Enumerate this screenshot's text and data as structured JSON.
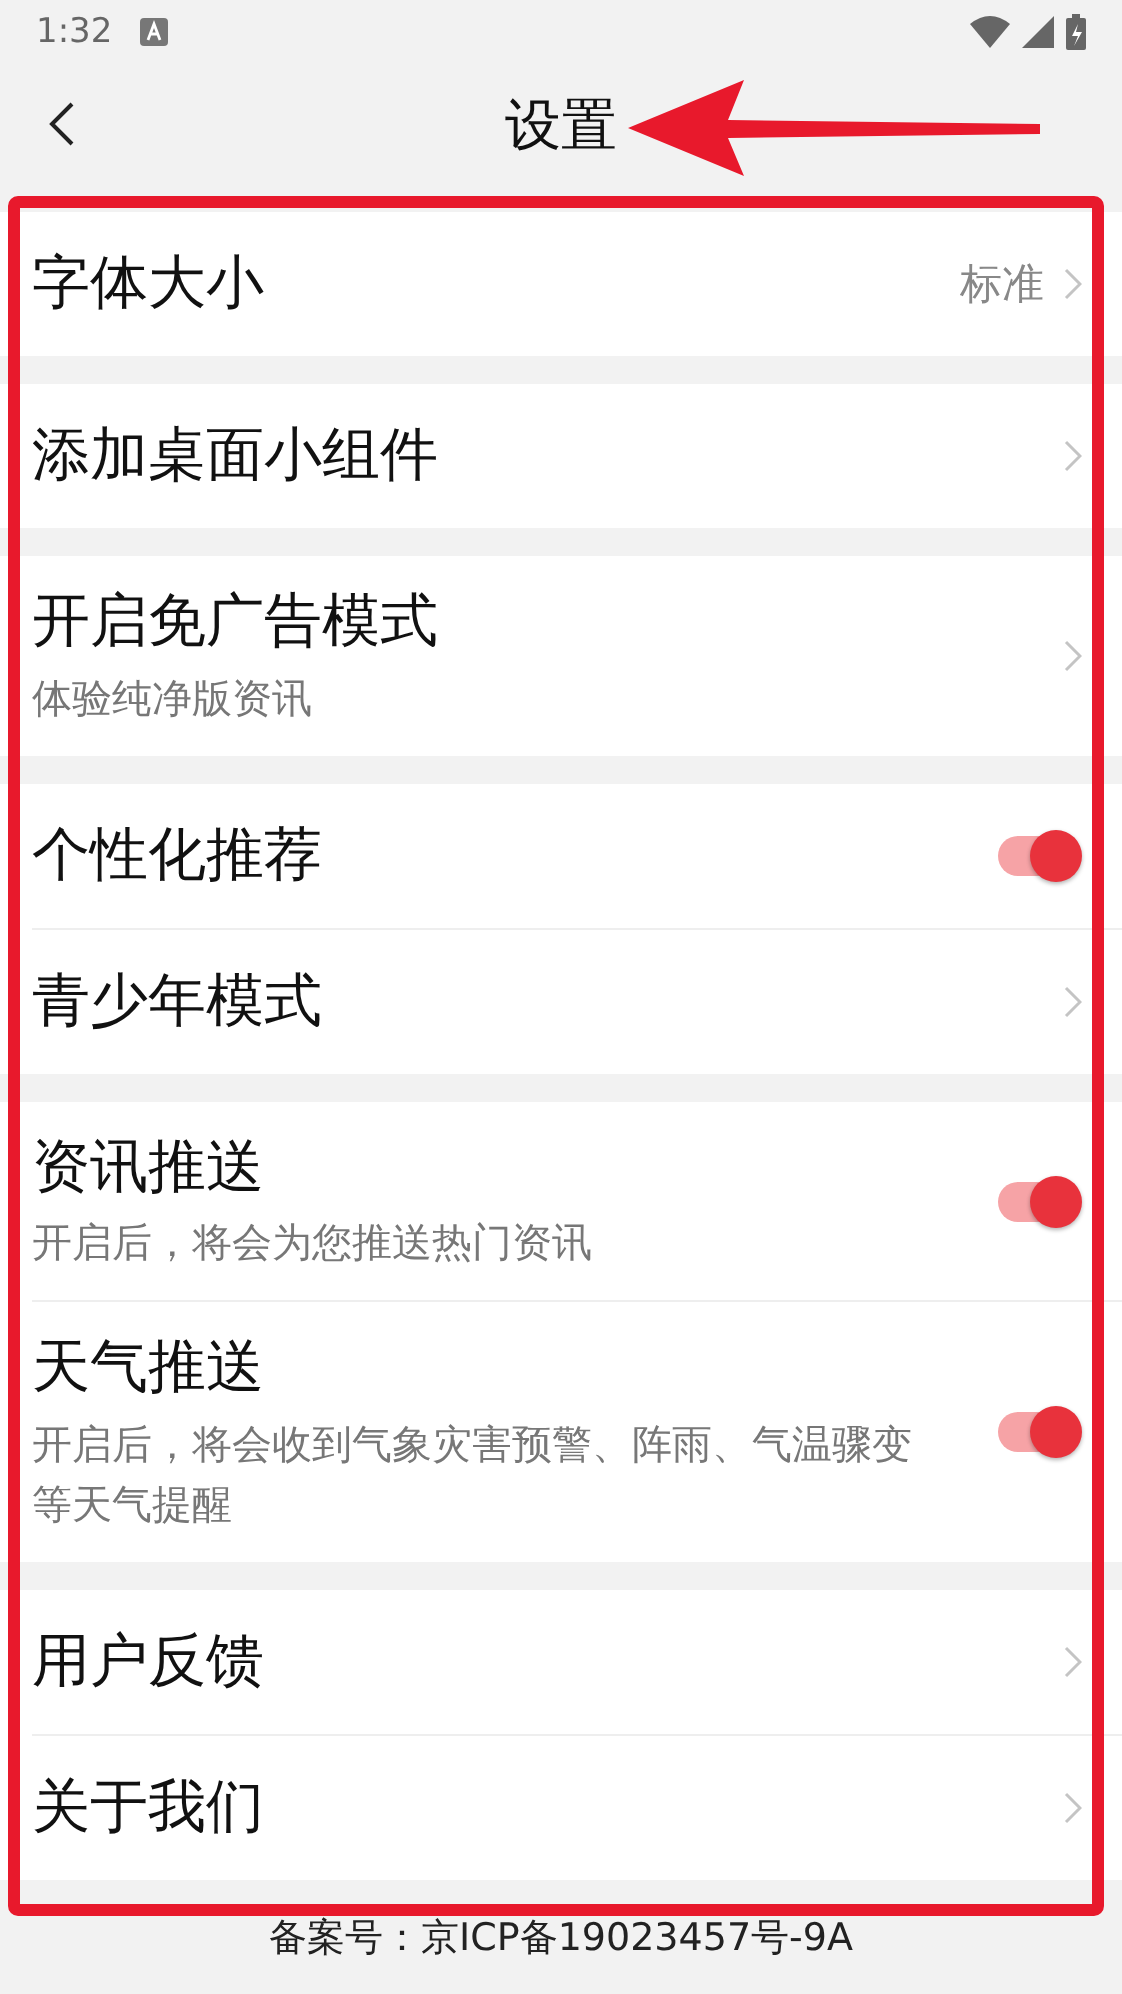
{
  "status_bar": {
    "time": "1:32"
  },
  "header": {
    "title": "设置"
  },
  "groups": [
    {
      "items": [
        {
          "kind": "chevron",
          "title": "字体大小",
          "value": "标准"
        }
      ]
    },
    {
      "items": [
        {
          "kind": "chevron",
          "title": "添加桌面小组件"
        }
      ]
    },
    {
      "items": [
        {
          "kind": "chevron",
          "title": "开启免广告模式",
          "subtitle": "体验纯净版资讯"
        }
      ]
    },
    {
      "items": [
        {
          "kind": "toggle",
          "title": "个性化推荐",
          "on": true
        },
        {
          "kind": "chevron",
          "title": "青少年模式"
        }
      ]
    },
    {
      "items": [
        {
          "kind": "toggle",
          "title": "资讯推送",
          "subtitle": "开启后，将会为您推送热门资讯",
          "on": true
        },
        {
          "kind": "toggle",
          "title": "天气推送",
          "subtitle": "开启后，将会收到气象灾害预警、阵雨、气温骤变等天气提醒",
          "on": true
        }
      ]
    },
    {
      "items": [
        {
          "kind": "chevron",
          "title": "用户反馈"
        },
        {
          "kind": "chevron",
          "title": "关于我们"
        }
      ]
    }
  ],
  "footer": "备案号：京ICP备19023457号-9A",
  "annotations": {
    "frame": true,
    "arrow": true
  }
}
